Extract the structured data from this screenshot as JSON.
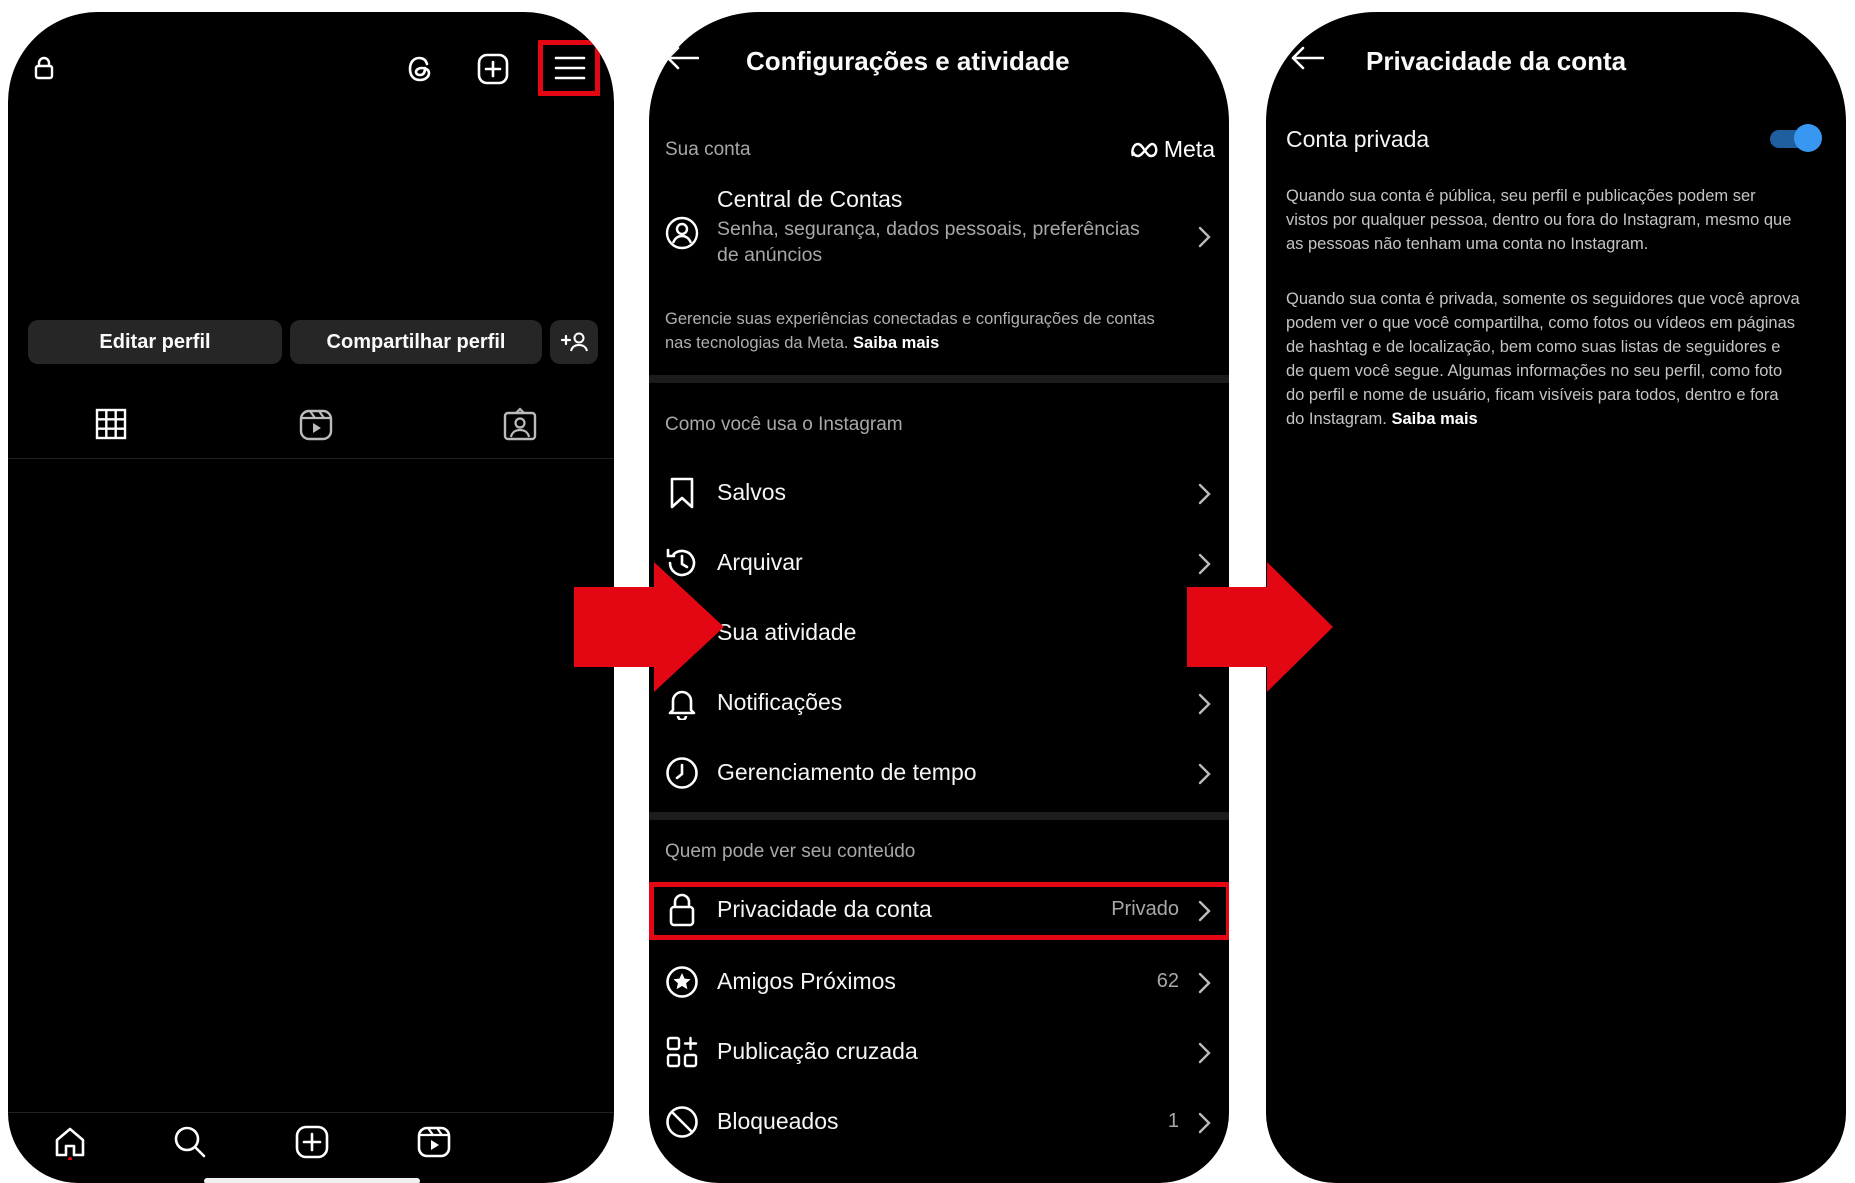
{
  "colors": {
    "highlight": "#e30613",
    "accent": "#3897f0",
    "background": "#000000"
  },
  "profile": {
    "icons": [
      "lock-icon",
      "threads-icon",
      "add-post-icon",
      "menu-icon"
    ],
    "edit_profile": "Editar perfil",
    "share_profile": "Compartilhar perfil",
    "tabs": [
      "grid-icon",
      "reels-icon",
      "tagged-icon"
    ],
    "nav": [
      "home-icon",
      "search-icon",
      "create-icon",
      "reels-nav-icon"
    ]
  },
  "settings": {
    "title": "Configurações e atividade",
    "your_account": "Sua conta",
    "meta_brand": "Meta",
    "accounts_center": {
      "title": "Central de Contas",
      "subtitle_line1": "Senha, segurança, dados pessoais, preferências",
      "subtitle_line2": "de anúncios"
    },
    "manage_note_line1": "Gerencie suas experiências conectadas e configurações de contas",
    "manage_note_line2": "nas tecnologias da Meta.",
    "learn_more": "Saiba mais",
    "section_usage": "Como você usa o Instagram",
    "usage_items": [
      {
        "label": "Salvos",
        "icon": "bookmark-icon"
      },
      {
        "label": "Arquivar",
        "icon": "archive-icon"
      },
      {
        "label": "Sua atividade",
        "icon": "activity-icon"
      },
      {
        "label": "Notificações",
        "icon": "bell-icon"
      },
      {
        "label": "Gerenciamento de tempo",
        "icon": "clock-icon"
      }
    ],
    "section_content": "Quem pode ver seu conteúdo",
    "content_items": [
      {
        "label": "Privacidade da conta",
        "value": "Privado",
        "icon": "lock-icon"
      },
      {
        "label": "Amigos Próximos",
        "value": "62",
        "icon": "star-circle-icon"
      },
      {
        "label": "Publicação cruzada",
        "value": "",
        "icon": "crosspost-icon"
      },
      {
        "label": "Bloqueados",
        "value": "1",
        "icon": "block-icon"
      }
    ]
  },
  "privacy": {
    "title": "Privacidade da conta",
    "toggle_label": "Conta privada",
    "toggle_on": true,
    "para1_lines": [
      "Quando sua conta é pública, seu perfil e publicações podem ser",
      "vistos por qualquer pessoa, dentro ou fora do Instagram, mesmo que",
      "as pessoas não tenham uma conta no Instagram."
    ],
    "para2_lines": [
      "Quando sua conta é privada, somente os seguidores que você aprova",
      "podem ver o que você compartilha, como fotos ou vídeos em páginas",
      "de hashtag e de localização, bem como suas listas de seguidores e",
      "de quem você segue. Algumas informações no seu perfil, como foto",
      "do perfil e nome de usuário, ficam visíveis para todos, dentro e fora",
      "do Instagram."
    ],
    "learn_more": "Saiba mais"
  }
}
